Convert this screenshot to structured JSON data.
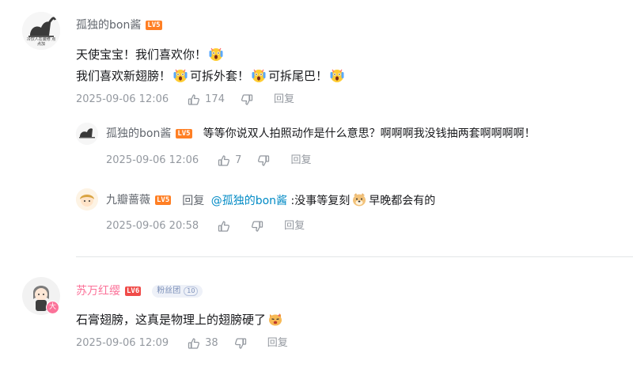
{
  "comments": [
    {
      "user": "孤独的bon酱",
      "level": "LV5",
      "avatar_caption": "冷饮人在装修 点点加",
      "lines": [
        "天使宝宝！我们喜欢你！",
        "我们喜欢新翅膀！",
        "可拆外套！",
        "可拆尾巴！"
      ],
      "time": "2025-09-06 12:06",
      "likes": "174",
      "reply_label": "回复"
    },
    {
      "user": "苏万红缨",
      "level": "LV6",
      "fan_badge": "粉丝团",
      "fan_level": "10",
      "avatar_badge": "大",
      "text": "石膏翅膀，这真是物理上的翅膀硬了",
      "time": "2025-09-06 12:09",
      "likes": "38",
      "reply_label": "回复"
    }
  ],
  "replies": [
    {
      "user": "孤独的bon酱",
      "level": "LV5",
      "text": "等等你说双人拍照动作是什么意思？啊啊啊我没钱抽两套啊啊啊啊！",
      "time": "2025-09-06 12:06",
      "likes": "7",
      "reply_label": "回复"
    },
    {
      "user": "九瓣蔷薇",
      "level": "LV5",
      "reply_prefix": "回复",
      "mention": "@孤独的bon酱",
      "text_before": " :没事等复刻",
      "text_after": "早晚都会有的",
      "time": "2025-09-06 20:58",
      "likes": "",
      "reply_label": "回复"
    }
  ],
  "icons": {
    "like": "thumbs-up-icon",
    "dislike": "thumbs-down-icon",
    "emoji_scream": "screaming-face-emoji",
    "emoji_dog": "doge-emoji",
    "emoji_cat": "cat-face-emoji"
  },
  "colors": {
    "level_badge": "#ff7f24",
    "level_badge_red": "#f04c49",
    "mention": "#008ac5",
    "pink_name": "#fb7299",
    "meta": "#9499a0"
  }
}
